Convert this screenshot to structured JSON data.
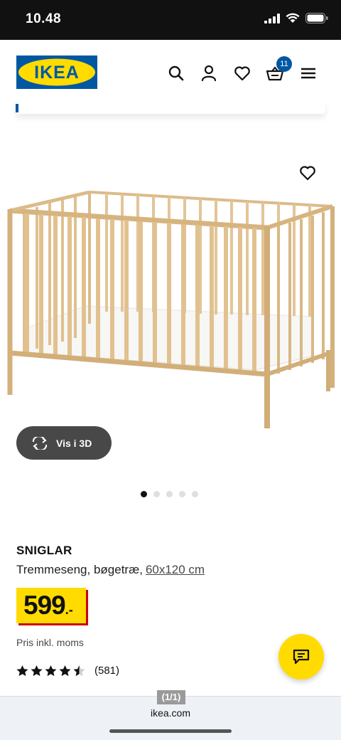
{
  "status_bar": {
    "time": "10.48"
  },
  "header": {
    "brand": "IKEA",
    "cart_count": "11"
  },
  "product": {
    "name": "SNIGLAR",
    "description": "Tremmeseng, bøgetræ,",
    "size": "60x120 cm",
    "price_value": "599",
    "price_suffix": ".-",
    "price_note": "Pris inkl. moms",
    "rating_stars": 4.5,
    "review_count": "(581)",
    "view3d_label": "Vis i 3D",
    "image_count": 5,
    "active_image": 1
  },
  "browser": {
    "page_indicator": "(1/1)",
    "domain": "ikea.com"
  },
  "colors": {
    "ikea_blue": "#0058a3",
    "ikea_yellow": "#ffdb00",
    "price_shadow_red": "#cc0008"
  },
  "icons": [
    "search-icon",
    "user-icon",
    "heart-icon",
    "cart-icon",
    "menu-icon",
    "rotate-3d-icon",
    "star-icon",
    "chat-icon"
  ]
}
